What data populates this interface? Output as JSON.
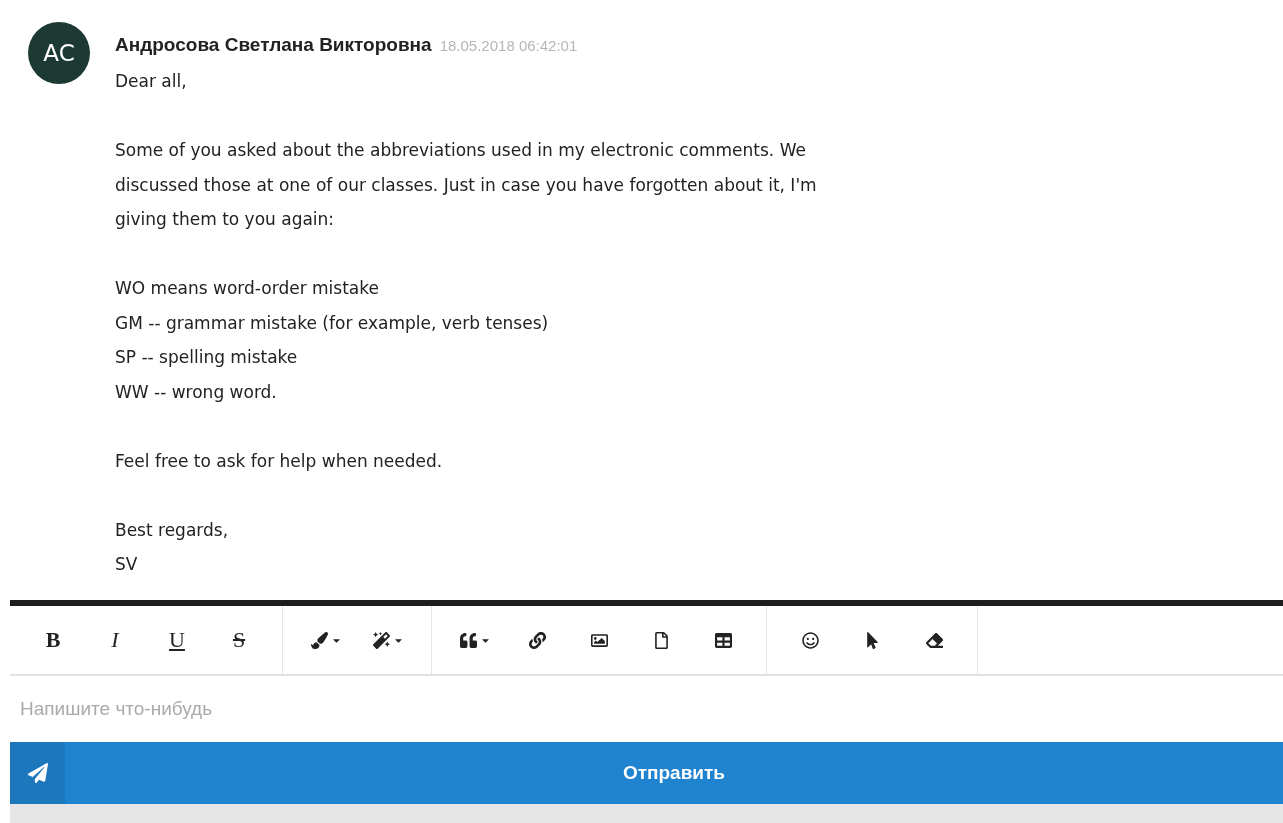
{
  "message": {
    "avatar": "AC",
    "author": "Андросова Светлана Викторовна",
    "time": "18.05.2018 06:42:01",
    "paragraphs": [
      [
        "Dear all,"
      ],
      [
        "Some of you asked about the abbreviations used in my electronic comments. We",
        "discussed those at one of our classes. Just in case you have forgotten about it, I'm",
        "giving them to you again:"
      ],
      [
        "WO means word-order mistake",
        "GM -- grammar mistake (for example, verb tenses)",
        "SP -- spelling mistake",
        "WW -- wrong word."
      ],
      [
        "Feel free to ask for help when needed."
      ],
      [
        "Best regards,",
        "SV"
      ]
    ]
  },
  "toolbar": [
    [
      {
        "kind": "text",
        "label": "B"
      },
      {
        "kind": "text",
        "label": "I"
      },
      {
        "kind": "text",
        "label": "U"
      },
      {
        "kind": "text",
        "label": "S"
      }
    ],
    [
      {
        "kind": "icon",
        "dropdown": true
      },
      {
        "kind": "icon",
        "dropdown": true
      }
    ],
    [
      {
        "kind": "icon",
        "dropdown": true
      },
      {
        "kind": "icon",
        "dropdown": false
      },
      {
        "kind": "icon",
        "dropdown": false
      },
      {
        "kind": "icon",
        "dropdown": false
      },
      {
        "kind": "icon",
        "dropdown": false
      }
    ],
    [
      {
        "kind": "icon",
        "dropdown": false
      },
      {
        "kind": "icon",
        "dropdown": false
      },
      {
        "kind": "icon",
        "dropdown": false
      }
    ]
  ],
  "editor": {
    "placeholder": "Напишите что-нибудь"
  },
  "send_button": {
    "label": "Отправить"
  }
}
